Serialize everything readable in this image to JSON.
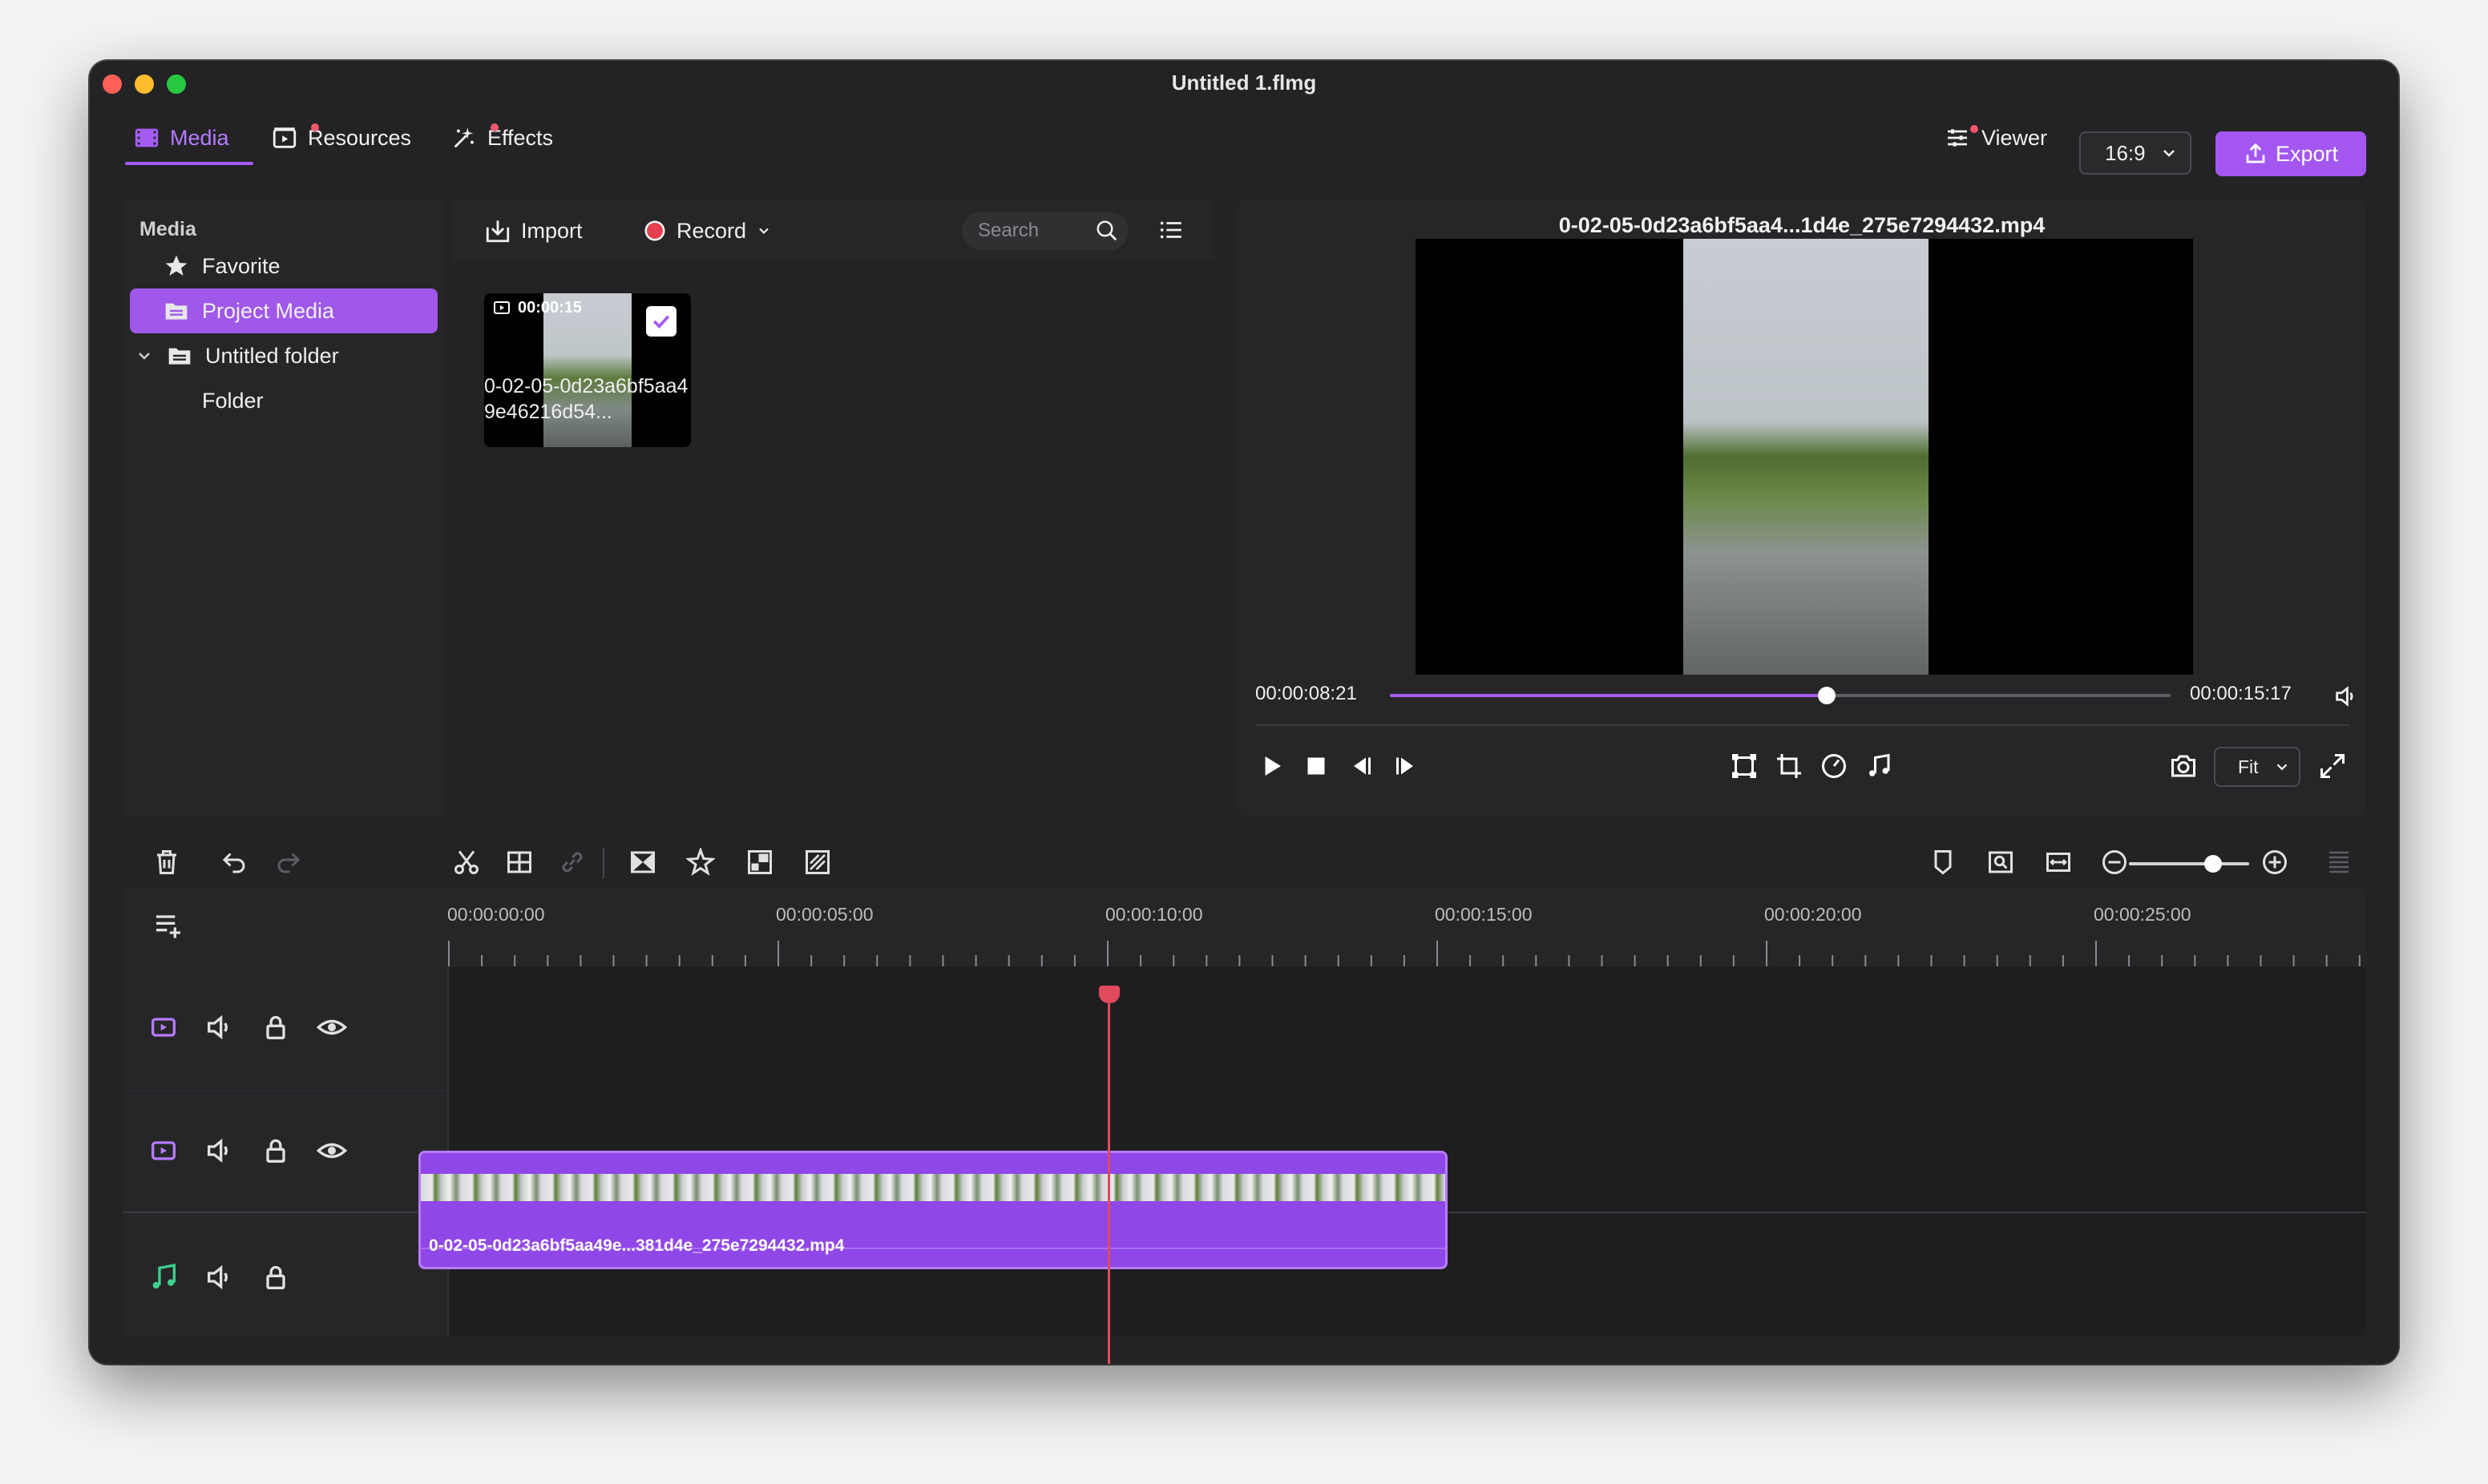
{
  "window": {
    "title": "Untitled 1.flmg"
  },
  "tabs": [
    {
      "label": "Media",
      "icon": "film-icon",
      "active": true
    },
    {
      "label": "Resources",
      "icon": "resources-icon",
      "active": false,
      "has_dot": true
    },
    {
      "label": "Effects",
      "icon": "sparkle-icon",
      "active": false,
      "has_dot": true
    }
  ],
  "header_right": {
    "viewer_label": "Viewer",
    "aspect_ratio": "16:9",
    "export_label": "Export"
  },
  "media_tree": {
    "header": "Media",
    "items": [
      {
        "label": "Favorite",
        "icon": "star-icon"
      },
      {
        "label": "Project Media",
        "icon": "folder-icon",
        "selected": true
      },
      {
        "label": "Untitled folder",
        "icon": "folder-icon",
        "expanded": true
      },
      {
        "label": "Folder",
        "icon": "none"
      }
    ]
  },
  "media_browser": {
    "import_label": "Import",
    "record_label": "Record",
    "search_placeholder": "Search",
    "items": [
      {
        "duration": "00:00:15",
        "name": "0-02-05-0d23a6bf5aa49e46216d54...",
        "checked": true
      }
    ]
  },
  "preview": {
    "file_title": "0-02-05-0d23a6bf5aa4...1d4e_275e7294432.mp4",
    "current_time": "00:00:08:21",
    "total_time": "00:00:15:17",
    "progress": 0.56,
    "fit_label": "Fit"
  },
  "timeline": {
    "ruler_labels": [
      "00:00:00:00",
      "00:00:05:00",
      "00:00:10:00",
      "00:00:15:00",
      "00:00:20:00",
      "00:00:25:00"
    ],
    "clip_name": "0-02-05-0d23a6bf5aa49e...381d4e_275e7294432.mp4",
    "zoom_level": 0.7
  },
  "colors": {
    "accent": "#a457f0",
    "playhead": "#e14a5c",
    "audio_track": "#3ecf8e"
  }
}
